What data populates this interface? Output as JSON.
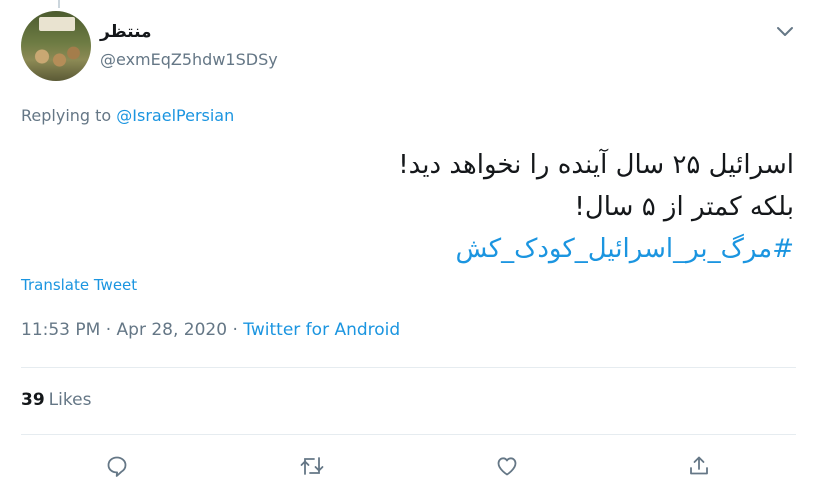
{
  "user": {
    "display_name": "منتظر",
    "handle": "@exmEqZ5hdw1SDSy"
  },
  "reply": {
    "prefix": "Replying to",
    "mention": "@IsraelPersian"
  },
  "tweet": {
    "line1": "اسرائیل ۲۵ سال آینده را نخواهد دید!",
    "line2": "بلکه کمتر از ۵ سال!",
    "hashtag": "#مرگ_بر_اسرائیل_کودک_کش"
  },
  "translate_label": "Translate Tweet",
  "meta": {
    "time": "11:53 PM",
    "separator1": " · ",
    "date": "Apr 28, 2020",
    "separator2": " · ",
    "source": "Twitter for Android"
  },
  "stats": {
    "likes_count": "39",
    "likes_label": "Likes"
  },
  "icons": {
    "caret": "chevron-down-icon",
    "reply": "reply-icon",
    "retweet": "retweet-icon",
    "like": "heart-icon",
    "share": "share-icon"
  },
  "colors": {
    "link": "#1b95e0",
    "secondary_text": "#657786",
    "primary_text": "#14171a",
    "divider": "#e6ecf0"
  }
}
